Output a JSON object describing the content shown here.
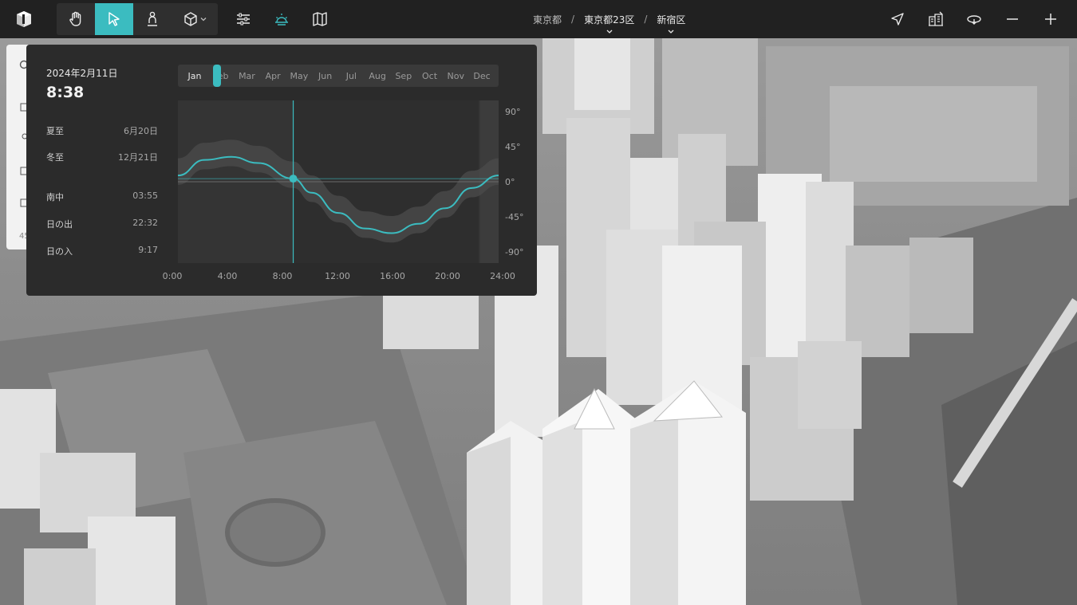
{
  "toolbar": {
    "tools": [
      "hand-tool",
      "select-tool",
      "pedestrian-tool",
      "box-tool",
      "settings-tool",
      "sun-tool",
      "map-tool"
    ]
  },
  "breadcrumb": {
    "items": [
      "東京都",
      "東京都23区",
      "新宿区"
    ]
  },
  "sun": {
    "date": "2024年2月11日",
    "time": "8:38",
    "summer_solstice_label": "夏至",
    "summer_solstice_value": "6月20日",
    "winter_solstice_label": "冬至",
    "winter_solstice_value": "12月21日",
    "culmination_label": "南中",
    "culmination_value": "03:55",
    "sunrise_label": "日の出",
    "sunrise_value": "22:32",
    "sunset_label": "日の入",
    "sunset_value": "9:17",
    "months": [
      "Jan",
      "Feb",
      "Mar",
      "Apr",
      "May",
      "Jun",
      "Jul",
      "Aug",
      "Sep",
      "Oct",
      "Nov",
      "Dec"
    ],
    "selected_month": "Jan",
    "y_ticks": [
      "90°",
      "45°",
      "0°",
      "-45°",
      "-90°"
    ],
    "x_ticks": [
      "0:00",
      "4:00",
      "8:00",
      "12:00",
      "16:00",
      "20:00",
      "24:00"
    ],
    "accent": "#3bbcc0"
  },
  "sidebar": {
    "count": "45"
  },
  "chart_data": {
    "type": "line",
    "title": "",
    "xlabel": "",
    "ylabel": "",
    "x": [
      0,
      2,
      4,
      6,
      8.63,
      10,
      12,
      14,
      16,
      18,
      20,
      22,
      24
    ],
    "series": [
      {
        "values": [
          8,
          28,
          32,
          24,
          4,
          -14,
          -40,
          -60,
          -66,
          -54,
          -34,
          -8,
          8
        ]
      }
    ],
    "xlim": [
      0,
      24
    ],
    "ylim": [
      -90,
      90
    ],
    "cursor": {
      "time": "8:38",
      "altitude": 4
    }
  }
}
